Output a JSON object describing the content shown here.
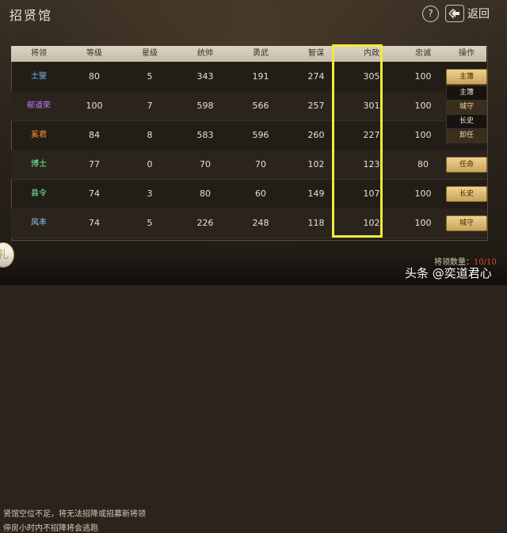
{
  "window": {
    "title": "招贤馆"
  },
  "topbar": {
    "help_label": "?",
    "back_label": "返回"
  },
  "table": {
    "columns": [
      "将领",
      "等级",
      "星级",
      "统帅",
      "勇武",
      "智谋",
      "内政",
      "忠诚",
      "操作"
    ],
    "rows": [
      {
        "name": "士燮",
        "name_color": "#7bb0ff",
        "level": "80",
        "stars": "5",
        "command": "343",
        "valor": "191",
        "wisdom": "274",
        "politics": "305",
        "loyalty": "100",
        "action": "主簿"
      },
      {
        "name": "郗道荣",
        "name_color": "#c37cff",
        "level": "100",
        "stars": "7",
        "command": "598",
        "valor": "566",
        "wisdom": "257",
        "politics": "301",
        "loyalty": "100",
        "action": ""
      },
      {
        "name": "奚君",
        "name_color": "#ff9a33",
        "level": "84",
        "stars": "8",
        "command": "583",
        "valor": "596",
        "wisdom": "260",
        "politics": "227",
        "loyalty": "100",
        "action": ""
      },
      {
        "name": "博士",
        "name_color": "#78ff9b",
        "level": "77",
        "stars": "0",
        "command": "70",
        "valor": "70",
        "wisdom": "102",
        "politics": "123",
        "loyalty": "80",
        "action": "任命"
      },
      {
        "name": "县令",
        "name_color": "#78ff9b",
        "level": "74",
        "stars": "3",
        "command": "80",
        "valor": "60",
        "wisdom": "149",
        "politics": "107",
        "loyalty": "100",
        "action": "长史"
      },
      {
        "name": "风丰",
        "name_color": "#9ad0ff",
        "level": "74",
        "stars": "5",
        "command": "226",
        "valor": "248",
        "wisdom": "118",
        "politics": "102",
        "loyalty": "100",
        "action": "城守"
      }
    ]
  },
  "dropdown": {
    "items": [
      "主簿",
      "城守",
      "长史",
      "卸任"
    ]
  },
  "footer": {
    "line1": "贤馆空位不足，将无法招降或招募新将领",
    "line2_prefix": "停房",
    "line2_hours": "",
    "line2_suffix": "小时内不招降将会逃跑",
    "count_label": "将领数量：",
    "count_value": "10/10"
  },
  "watermark": "头条 @奕道君心",
  "badge_glyph": "礼",
  "colors": {
    "highlight": "#f2ea3b",
    "gold_button": "#e7c57a"
  }
}
